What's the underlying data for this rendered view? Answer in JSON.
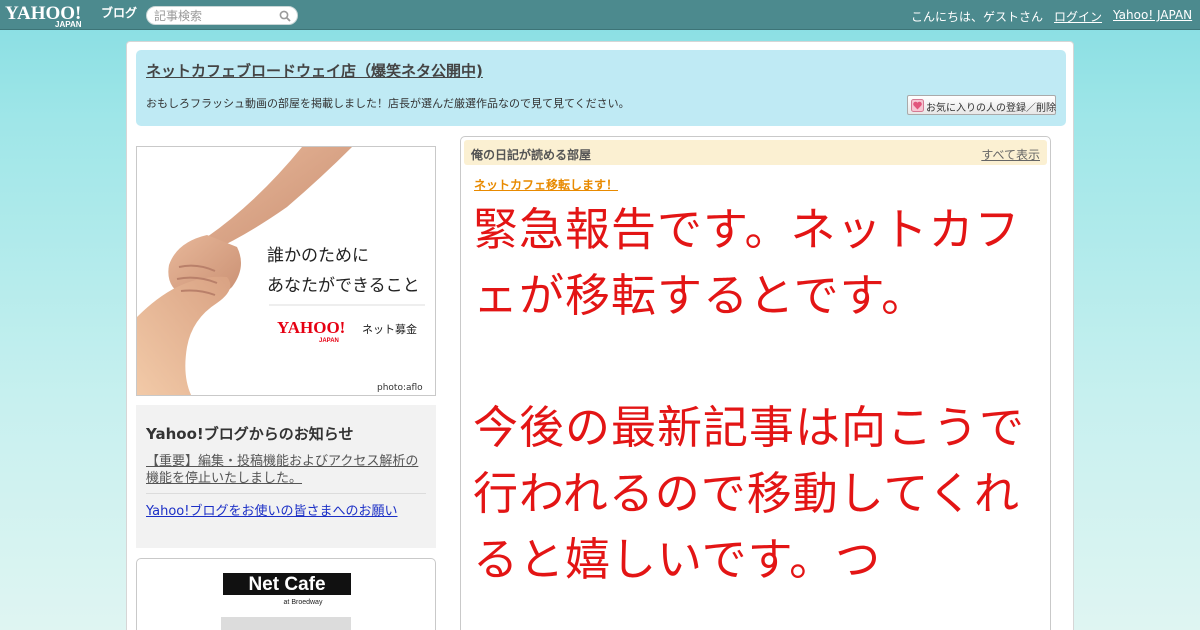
{
  "topbar": {
    "logo_text": "YAHOO!",
    "logo_sub": "JAPAN",
    "logo_blog": "ブログ",
    "search_placeholder": "記事検索",
    "greeting": "こんにちは、ゲストさん",
    "login_label": "ログイン",
    "yahoo_japan_label": "Yahoo! JAPAN"
  },
  "header": {
    "blog_title": "ネットカフェブロードウェイ店（爆笑ネタ公開中)",
    "description": "おもしろフラッシュ動画の部屋を掲載しました！店長が選んだ厳選作品なので見て見てください。",
    "favorite_button": "お気に入りの人の登録／削除"
  },
  "banner": {
    "line1": "誰かのために",
    "line2": "あなたができること",
    "logo": "YAHOO!",
    "logo_sub": "JAPAN",
    "service": "ネット募金",
    "credit": "photo:aflo"
  },
  "notice": {
    "title": "Yahoo!ブログからのお知らせ",
    "item1": "【重要】編集・投稿機能およびアクセス解析の機能を停止いたしました。",
    "item2": "Yahoo!ブログをお使いの皆さまへのお願い"
  },
  "netcafe": {
    "logo_main": "Net Cafe",
    "logo_sub": "at Broedway"
  },
  "diary": {
    "title": "俺の日記が読める部屋",
    "show_all": "すべて表示",
    "post_link": "ネットカフェ移転します！",
    "post_body": "緊急報告です。ネットカフェが移転するとです。\n\n今後の最新記事は向こうで行われるので移動してくれると嬉しいです。つ"
  },
  "colors": {
    "topbar": "#4c8a8e",
    "header_bg": "#bfeaf4",
    "diary_head_bg": "#fbf0d2",
    "post_text": "#e31515",
    "post_link": "#e88a00"
  }
}
